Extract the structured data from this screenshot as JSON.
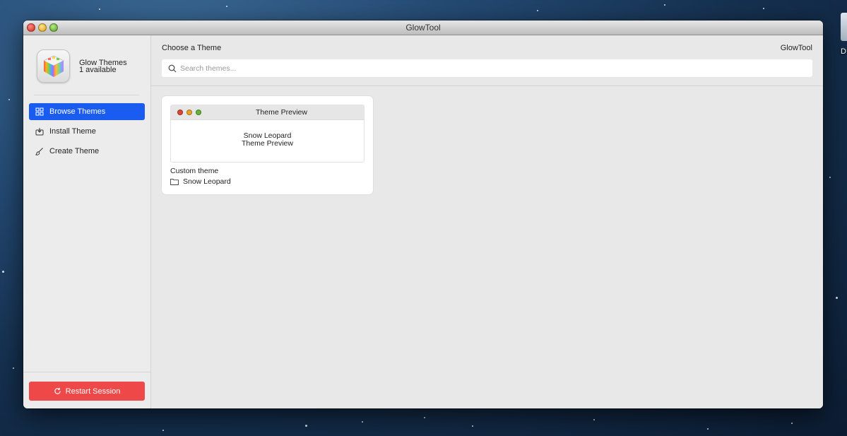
{
  "window": {
    "title": "GlowTool"
  },
  "desktop": {
    "icon_label": "D"
  },
  "sidebar": {
    "app_name": "Glow Themes",
    "app_subtitle": "1 available",
    "items": [
      {
        "label": "Browse Themes",
        "icon": "grid-icon",
        "active": true
      },
      {
        "label": "Install Theme",
        "icon": "install-icon",
        "active": false
      },
      {
        "label": "Create Theme",
        "icon": "brush-icon",
        "active": false
      }
    ],
    "restart_label": "Restart Session"
  },
  "main": {
    "section_title": "Choose a Theme",
    "app_name": "GlowTool",
    "search": {
      "placeholder": "Search themes...",
      "value": ""
    },
    "themes": [
      {
        "preview_title": "Theme Preview",
        "preview_line1": "Snow Leopard",
        "preview_line2": "Theme Preview",
        "type_label": "Custom theme",
        "folder_name": "Snow Leopard"
      }
    ]
  },
  "colors": {
    "accent": "#1a5cf0",
    "danger": "#ee4848"
  }
}
